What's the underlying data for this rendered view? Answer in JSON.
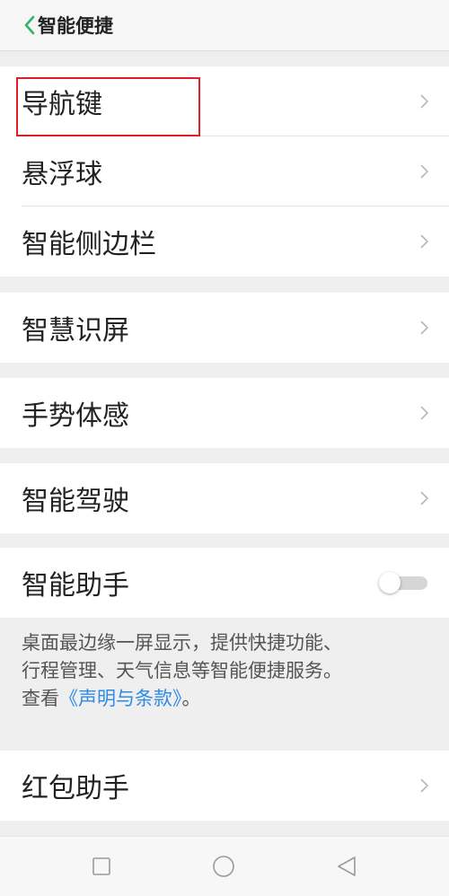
{
  "header": {
    "title": "智能便捷",
    "back_icon": "chevron-left-icon",
    "accent_color": "#2db36f"
  },
  "groups": [
    {
      "items": [
        {
          "label": "导航键",
          "control": "chevron",
          "highlighted": true
        },
        {
          "label": "悬浮球",
          "control": "chevron"
        },
        {
          "label": "智能侧边栏",
          "control": "chevron"
        }
      ]
    },
    {
      "items": [
        {
          "label": "智慧识屏",
          "control": "chevron"
        }
      ]
    },
    {
      "items": [
        {
          "label": "手势体感",
          "control": "chevron"
        }
      ]
    },
    {
      "items": [
        {
          "label": "智能驾驶",
          "control": "chevron"
        }
      ]
    },
    {
      "items": [
        {
          "label": "智能助手",
          "control": "toggle",
          "toggle_on": false
        }
      ]
    },
    {
      "items": [
        {
          "label": "红包助手",
          "control": "chevron"
        }
      ]
    }
  ],
  "assistant_description": {
    "text_line1": "桌面最边缘一屏显示，提供快捷功能、",
    "text_line2": "行程管理、天气信息等智能便捷服务。",
    "text_prefix": "查看",
    "link_text": "《声明与条款》",
    "text_suffix": "。",
    "link_color": "#2f8be6"
  },
  "highlight_color": "#e21f26",
  "navbar": {
    "buttons": [
      "recent-apps-icon",
      "home-icon",
      "back-icon"
    ]
  }
}
